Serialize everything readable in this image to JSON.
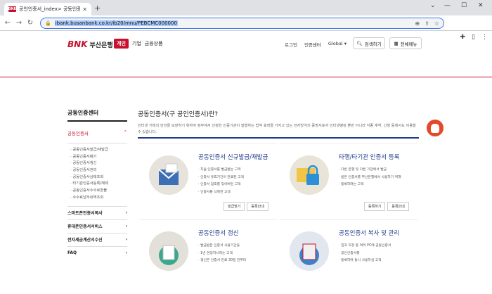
{
  "browser": {
    "tab_title": "공인인증서_index> 공동인증서 >",
    "tab_favicon": "BNK",
    "url": "ibank.busanbank.co.kr/ib20/mnu/PEBCMC000000",
    "accent": "#3b78e7"
  },
  "header": {
    "logo_brand": "BNK",
    "logo_name": "부산은행",
    "nav": [
      "개인",
      "기업",
      "금융상품"
    ],
    "util": [
      "로그인",
      "인증센터",
      "Global"
    ],
    "search_label": "검색하기",
    "menu_label": "전체메뉴",
    "brand_color": "#c8102e"
  },
  "sidebar": {
    "title": "공동인증센터",
    "current": "공동인증서",
    "items": [
      "공동인증서발급/재발급",
      "공동인증서폐기",
      "공동인증서갱신",
      "공동인증서관리",
      "공동인증서상태조회",
      "타기관인증서등록/해제",
      "공동인증서수수료환불",
      "수수료납부내역조회"
    ],
    "groups": [
      "스마트폰인증서복사",
      "휴대폰인증서서비스",
      "전자세금계산서수신",
      "FAQ"
    ]
  },
  "main": {
    "title": "공동인증서(구 공인인증서)란?",
    "description": "인터넷 거래의 안전을 보장하기 위하여 정부에서 인정한 인증기관이 발행하는 법적 효력을 가지고 있는 전자방식의 증명서로서 인터넷뱅킹 뿐만 아니라 각종 계약, 신청 등에서도 이용할 수 있습니다.",
    "cards": [
      {
        "title": "공동인증서 신규발급/재발급",
        "items": [
          "처음 인증서를 발급받는 고객",
          "인증서 유효기간이 만료된 고객",
          "인증서 암호를 잊어버린 고객",
          "인증서를 삭제한 고객"
        ],
        "buttons": [
          "발급받기",
          "등록안내"
        ]
      },
      {
        "title": "타행/타기관 인증서 등록",
        "items": [
          "다른 은행 및 다른 기관에서 발급",
          "받은 인증서를 부산은행에서 사용하기 위해",
          "등록하려는 고객"
        ],
        "buttons": [
          "등록하기",
          "등록안내"
        ]
      },
      {
        "title": "공동인증서 갱신",
        "items": [
          "발급받은 인증서 사용기간을",
          "1년 연장하시려는 고객",
          "갱신은 인증서 만료 30일 전부터"
        ],
        "buttons": []
      },
      {
        "title": "공동인증서 복사 및 관리",
        "items": [
          "집과 직장 등 여러 PC에 공동인증서",
          "공인인증서를",
          "등록하여 동시 사용하실 고객"
        ],
        "buttons": []
      }
    ]
  }
}
